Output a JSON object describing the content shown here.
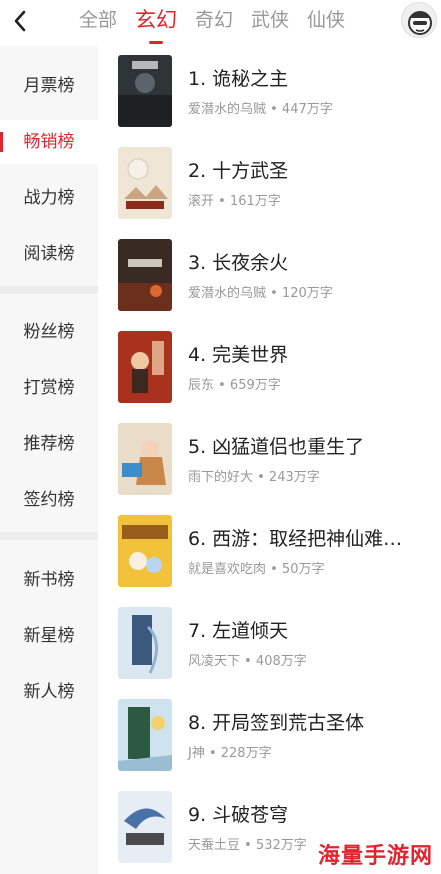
{
  "header": {
    "tabs": [
      {
        "label": "全部"
      },
      {
        "label": "玄幻"
      },
      {
        "label": "奇幻"
      },
      {
        "label": "武侠"
      },
      {
        "label": "仙侠"
      }
    ],
    "active_tab": "玄幻"
  },
  "sidebar": {
    "items": [
      {
        "label": "月票榜"
      },
      {
        "label": "畅销榜"
      },
      {
        "label": "战力榜"
      },
      {
        "label": "阅读榜"
      },
      {
        "label": "粉丝榜"
      },
      {
        "label": "打赏榜"
      },
      {
        "label": "推荐榜"
      },
      {
        "label": "签约榜"
      },
      {
        "label": "新书榜"
      },
      {
        "label": "新星榜"
      },
      {
        "label": "新人榜"
      }
    ],
    "active_item": "畅销榜"
  },
  "books": [
    {
      "title": "1. 诡秘之主",
      "meta": "爱潜水的乌贼 • 447万字",
      "cover_color": "#2f3438"
    },
    {
      "title": "2. 十方武圣",
      "meta": "滚开 • 161万字",
      "cover_color": "#efe6d6"
    },
    {
      "title": "3. 长夜余火",
      "meta": "爱潜水的乌贼 • 120万字",
      "cover_color": "#3a2a24"
    },
    {
      "title": "4. 完美世界",
      "meta": "辰东 • 659万字",
      "cover_color": "#a8321e"
    },
    {
      "title": "5. 凶猛道侣也重生了",
      "meta": "雨下的好大 • 243万字",
      "cover_color": "#e9dcc8"
    },
    {
      "title": "6. 西游：取经把神仙难…",
      "meta": "就是喜欢吃肉 • 50万字",
      "cover_color": "#f2c23a"
    },
    {
      "title": "7. 左道倾天",
      "meta": "风凌天下 • 408万字",
      "cover_color": "#dbe7f0"
    },
    {
      "title": "8. 开局签到荒古圣体",
      "meta": "J神 • 228万字",
      "cover_color": "#cfe3ef"
    },
    {
      "title": "9. 斗破苍穹",
      "meta": "天蚕土豆 • 532万字",
      "cover_color": "#e6edf4"
    }
  ],
  "watermark": "海量手游网",
  "colors": {
    "accent": "#e0252f"
  },
  "icons": {
    "back": "chevron-left-icon",
    "avatar": "avatar-icon"
  }
}
